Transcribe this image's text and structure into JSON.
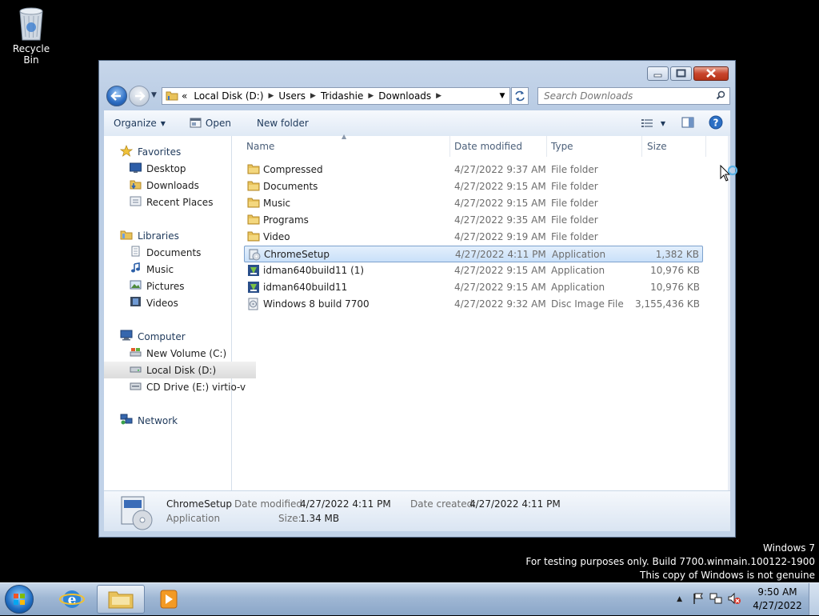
{
  "desktop": {
    "icons": [
      {
        "label": "Recycle Bin",
        "icon": "recycle-bin-icon"
      }
    ]
  },
  "window": {
    "address": {
      "overflow": "«",
      "crumbs": [
        "Local Disk (D:)",
        "Users",
        "Tridashie",
        "Downloads"
      ]
    },
    "search_placeholder": "Search Downloads",
    "toolbar": {
      "organize": "Organize",
      "open": "Open",
      "new_folder": "New folder"
    },
    "nav": {
      "favorites": {
        "label": "Favorites",
        "items": [
          "Desktop",
          "Downloads",
          "Recent Places"
        ]
      },
      "libraries": {
        "label": "Libraries",
        "items": [
          "Documents",
          "Music",
          "Pictures",
          "Videos"
        ]
      },
      "computer": {
        "label": "Computer",
        "items": [
          "New Volume (C:)",
          "Local Disk (D:)",
          "CD Drive (E:) virtio-v"
        ],
        "selected": "Local Disk (D:)"
      },
      "network": {
        "label": "Network"
      }
    },
    "columns": {
      "name": "Name",
      "date": "Date modified",
      "type": "Type",
      "size": "Size"
    },
    "files": [
      {
        "name": "Compressed",
        "date": "4/27/2022 9:37 AM",
        "type": "File folder",
        "size": "",
        "icon": "folder-icon"
      },
      {
        "name": "Documents",
        "date": "4/27/2022 9:15 AM",
        "type": "File folder",
        "size": "",
        "icon": "folder-icon"
      },
      {
        "name": "Music",
        "date": "4/27/2022 9:15 AM",
        "type": "File folder",
        "size": "",
        "icon": "folder-icon"
      },
      {
        "name": "Programs",
        "date": "4/27/2022 9:35 AM",
        "type": "File folder",
        "size": "",
        "icon": "folder-icon"
      },
      {
        "name": "Video",
        "date": "4/27/2022 9:19 AM",
        "type": "File folder",
        "size": "",
        "icon": "folder-icon"
      },
      {
        "name": "ChromeSetup",
        "date": "4/27/2022 4:11 PM",
        "type": "Application",
        "size": "1,382 KB",
        "icon": "installer-icon",
        "selected": true
      },
      {
        "name": "idman640build11 (1)",
        "date": "4/27/2022 9:15 AM",
        "type": "Application",
        "size": "10,976 KB",
        "icon": "idm-app-icon"
      },
      {
        "name": "idman640build11",
        "date": "4/27/2022 9:15 AM",
        "type": "Application",
        "size": "10,976 KB",
        "icon": "idm-app-icon"
      },
      {
        "name": "Windows 8 build 7700",
        "date": "4/27/2022 9:32 AM",
        "type": "Disc Image File",
        "size": "3,155,436 KB",
        "icon": "disc-image-icon"
      }
    ],
    "details": {
      "name": "ChromeSetup",
      "kind": "Application",
      "modified_label": "Date modified:",
      "modified_value": "4/27/2022 4:11 PM",
      "created_label": "Date created:",
      "created_value": "4/27/2022 4:11 PM",
      "size_label": "Size:",
      "size_value": "1.34 MB"
    }
  },
  "watermark": {
    "line1": "Windows 7",
    "line2": "For testing purposes only. Build 7700.winmain.100122-1900",
    "line3": "This copy of Windows is not genuine"
  },
  "taskbar": {
    "time": "9:50 AM",
    "date": "4/27/2022"
  },
  "colors": {
    "accent": "#1e395b",
    "selection": "#c9e0f9",
    "desktop": "#000000"
  }
}
